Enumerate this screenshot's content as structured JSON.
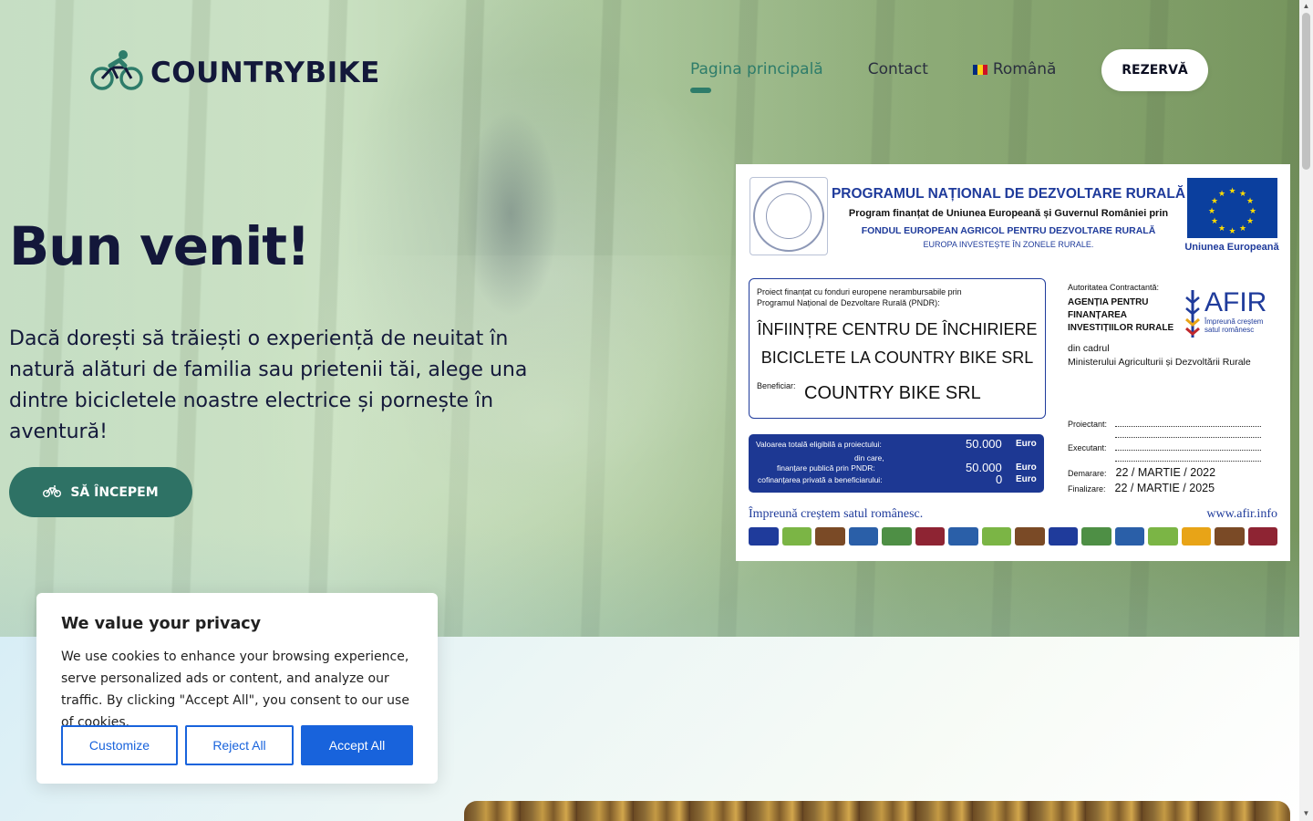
{
  "header": {
    "logo_text": "COUNTRYBIKE",
    "nav": [
      {
        "label": "Pagina principală"
      },
      {
        "label": "Contact"
      },
      {
        "label": "Română"
      }
    ],
    "reserve_label": "REZERVĂ"
  },
  "hero": {
    "title": "Bun venit!",
    "text": "Dacă dorești să trăiești o experiență de neuitat în natură alături de familia sau prietenii tăi, alege una dintre bicicletele noastre electrice și pornește în aventură!",
    "cta_label": "SĂ ÎNCEPEM"
  },
  "billboard": {
    "seal_text": "GUVERNUL ROMÂNIEI",
    "title": "PROGRAMUL NAȚIONAL DE DEZVOLTARE RURALĂ",
    "subtitle": "Program finanțat de Uniunea Europeană și Guvernul României prin",
    "fund": "FONDUL EUROPEAN AGRICOL PENTRU DEZVOLTARE RURALĂ",
    "motto": "EUROPA INVESTEȘTE ÎN ZONELE RURALE.",
    "eu_label": "Uniunea Europeană",
    "project_small_1": "Proiect finanțat cu fonduri europene nerambursabile prin",
    "project_small_2": "Programul Național de Dezvoltare Rurală (PNDR):",
    "project_title_1": "ÎNFIINȚRE CENTRU DE ÎNCHIRIERE",
    "project_title_2": "BICICLETE LA COUNTRY BIKE SRL",
    "beneficiary_label": "Beneficiar:",
    "beneficiary": "COUNTRY BIKE SRL",
    "value_total_label": "Valoarea totală eligibilă a proiectului:",
    "value_total": "50.000",
    "din_care": "din care,",
    "public_label": "finanțare publică prin PNDR:",
    "public_value": "50.000",
    "private_label": "cofinanțarea privată a beneficiarului:",
    "private_value": "0",
    "currency": "Euro",
    "authority_label": "Autoritatea Contractantă:",
    "authority_1": "AGENȚIA PENTRU",
    "authority_2": "FINANȚAREA",
    "authority_3": "INVESTIȚIILOR RURALE",
    "afir_logo": "AFIR",
    "afir_sub_1": "Împreună creștem",
    "afir_sub_2": "satul românesc",
    "ministry_1": "din cadrul",
    "ministry_2": "Ministerului Agriculturii și Dezvoltării Rurale",
    "designer_label": "Proiectant:",
    "contractor_label": "Executant:",
    "start_label": "Demarare:",
    "start_value": "22 / MARTIE / 2022",
    "end_label": "Finalizare:",
    "end_value": "22 / MARTIE / 2025",
    "footer_motto": "Împreună creștem satul românesc.",
    "footer_url": "www.afir.info"
  },
  "cookie": {
    "title": "We value your privacy",
    "text": "We use cookies to enhance your browsing experience, serve personalized ads or content, and analyze our traffic. By clicking \"Accept All\", you consent to our use of cookies.",
    "customize": "Customize",
    "reject": "Reject All",
    "accept": "Accept All"
  },
  "colors": {
    "brand_dark": "#13183a",
    "accent_green": "#2e7c6a",
    "cookie_blue": "#1863dc",
    "pndr_blue": "#1f3b9b"
  }
}
